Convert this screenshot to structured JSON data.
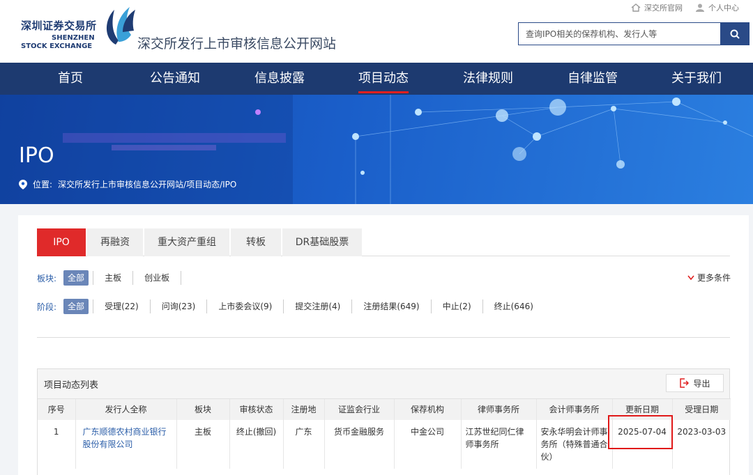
{
  "header": {
    "logo_cn": "深圳证券交易所",
    "logo_en1": "SHENZHEN",
    "logo_en2": "STOCK EXCHANGE",
    "site_title": "深交所发行上市审核信息公开网站",
    "toplinks": [
      "深交所官网",
      "个人中心"
    ],
    "search_placeholder": "查询IPO相关的保荐机构、发行人等"
  },
  "nav": {
    "items": [
      "首页",
      "公告通知",
      "信息披露",
      "项目动态",
      "法律规则",
      "自律监管",
      "关于我们"
    ],
    "active": "项目动态"
  },
  "banner": {
    "title": "IPO",
    "location_label": "位置:",
    "breadcrumb": "深交所发行上市审核信息公开网站/项目动态/IPO"
  },
  "tabs": [
    "IPO",
    "再融资",
    "重大资产重组",
    "转板",
    "DR基础股票"
  ],
  "filters": {
    "board": {
      "label": "板块:",
      "options": [
        "全部",
        "主板",
        "创业板"
      ]
    },
    "stage": {
      "label": "阶段:",
      "options": [
        "全部",
        "受理(22)",
        "问询(23)",
        "上市委会议(9)",
        "提交注册(4)",
        "注册结果(649)",
        "中止(2)",
        "终止(646)"
      ]
    },
    "more": "更多条件"
  },
  "list": {
    "title": "项目动态列表",
    "export": "导出",
    "columns": [
      "序号",
      "发行人全称",
      "板块",
      "审核状态",
      "注册地",
      "证监会行业",
      "保荐机构",
      "律师事务所",
      "会计师事务所",
      "更新日期",
      "受理日期"
    ],
    "rows": [
      [
        "1",
        "广东顺德农村商业银行股份有限公司",
        "主板",
        "终止(撤回)",
        "广东",
        "货币金融服务",
        "中金公司",
        "江苏世纪同仁律师事务所",
        "安永华明会计师事务所（特殊普通合伙）",
        "2025-07-04",
        "2023-03-03"
      ]
    ]
  },
  "colors": {
    "nav_bg": "#1d3a70",
    "accent_red": "#e02a2a",
    "link_blue": "#2a5da8"
  }
}
